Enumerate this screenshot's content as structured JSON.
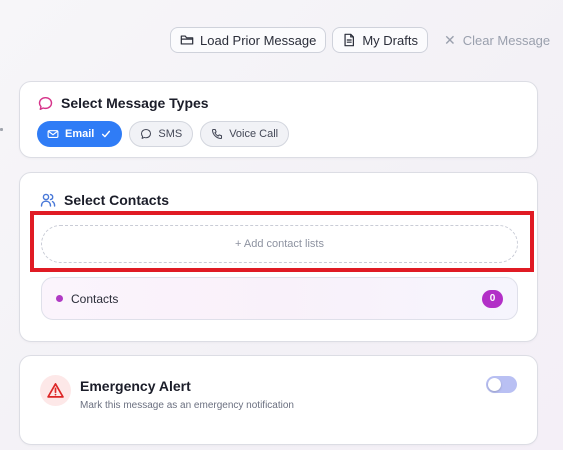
{
  "toolbar": {
    "load_label": "Load Prior Message",
    "drafts_label": "My Drafts",
    "clear_label": "Clear Message"
  },
  "message_types": {
    "title": "Select Message Types",
    "options": [
      {
        "label": "Email",
        "selected": true,
        "icon": "mail-icon"
      },
      {
        "label": "SMS",
        "selected": false,
        "icon": "message-bubble-icon"
      },
      {
        "label": "Voice Call",
        "selected": false,
        "icon": "phone-icon"
      }
    ]
  },
  "contacts": {
    "title": "Select Contacts",
    "add_label": "+ Add contact lists",
    "row_label": "Contacts",
    "count": "0"
  },
  "emergency": {
    "title": "Emergency Alert",
    "subtitle": "Mark this message as an emergency notification",
    "enabled": false
  },
  "colors": {
    "accent": "#2f7cf6",
    "badge": "#b22fc7",
    "highlight": "#e01b24",
    "alert": "#dc2626"
  }
}
